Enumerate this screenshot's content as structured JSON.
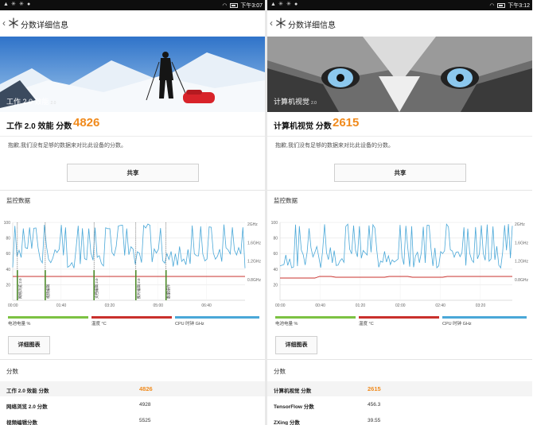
{
  "left": {
    "status": {
      "time": "下午3:07"
    },
    "appbar": {
      "title": "分数详细信息"
    },
    "hero": {
      "label": "工作 2.0 效能",
      "badge": "2.0"
    },
    "score": {
      "label": "工作 2.0 效能 分数",
      "value": "4826"
    },
    "sorry": "抱歉,我们没有足够的数据来对比此设备的分数。",
    "share_label": "共享",
    "monitor_title": "监控数据",
    "chart_data": {
      "type": "line",
      "x_ticks": [
        "00:00",
        "01:40",
        "03:20",
        "05:00",
        "06:40"
      ],
      "y_left_ticks": [
        "100",
        "80",
        "60",
        "40",
        "20"
      ],
      "y_right_ticks": [
        "2GHz",
        "1.6GHz",
        "1.2GHz",
        "0.8GHz"
      ],
      "markers": [
        "网络浏览 2.0",
        "视频编辑",
        "文档编辑 2.0",
        "照片编辑 2.0",
        "数据操作"
      ],
      "series": [
        {
          "name": "电池电量 %",
          "color": "#7cc242"
        },
        {
          "name": "温度 °C",
          "color": "#c9302c"
        },
        {
          "name": "CPU 时钟 GHz",
          "color": "#4aa8d8"
        }
      ]
    },
    "detail_label": "详细图表",
    "scores_title": "分数",
    "rows": [
      {
        "label": "工作 2.0 效能 分数",
        "value": "4826"
      },
      {
        "label": "网络浏览 2.0 分数",
        "value": "4928"
      },
      {
        "label": "视频编辑分数",
        "value": "5525"
      }
    ]
  },
  "right": {
    "status": {
      "time": "下午3:12"
    },
    "appbar": {
      "title": "分数详细信息"
    },
    "hero": {
      "label": "计算机视觉",
      "badge": "2.0"
    },
    "score": {
      "label": "计算机视觉 分数",
      "value": "2615"
    },
    "sorry": "抱歉,我们没有足够的数据来对比此设备的分数。",
    "share_label": "共享",
    "monitor_title": "监控数据",
    "chart_data": {
      "type": "line",
      "x_ticks": [
        "00:00",
        "00:40",
        "01:20",
        "02:00",
        "02:40",
        "03:20"
      ],
      "y_left_ticks": [
        "100",
        "80",
        "60",
        "40",
        "20"
      ],
      "y_right_ticks": [
        "2GHz",
        "1.6GHz",
        "1.2GHz",
        "0.8GHz"
      ],
      "series": [
        {
          "name": "电池电量 %",
          "color": "#7cc242"
        },
        {
          "name": "温度 °C",
          "color": "#c9302c"
        },
        {
          "name": "CPU 时钟 GHz",
          "color": "#4aa8d8"
        }
      ]
    },
    "detail_label": "详细图表",
    "scores_title": "分数",
    "rows": [
      {
        "label": "计算机视觉 分数",
        "value": "2615"
      },
      {
        "label": "TensorFlow 分数",
        "value": "456.3"
      },
      {
        "label": "ZXing 分数",
        "value": "39.55"
      }
    ]
  }
}
